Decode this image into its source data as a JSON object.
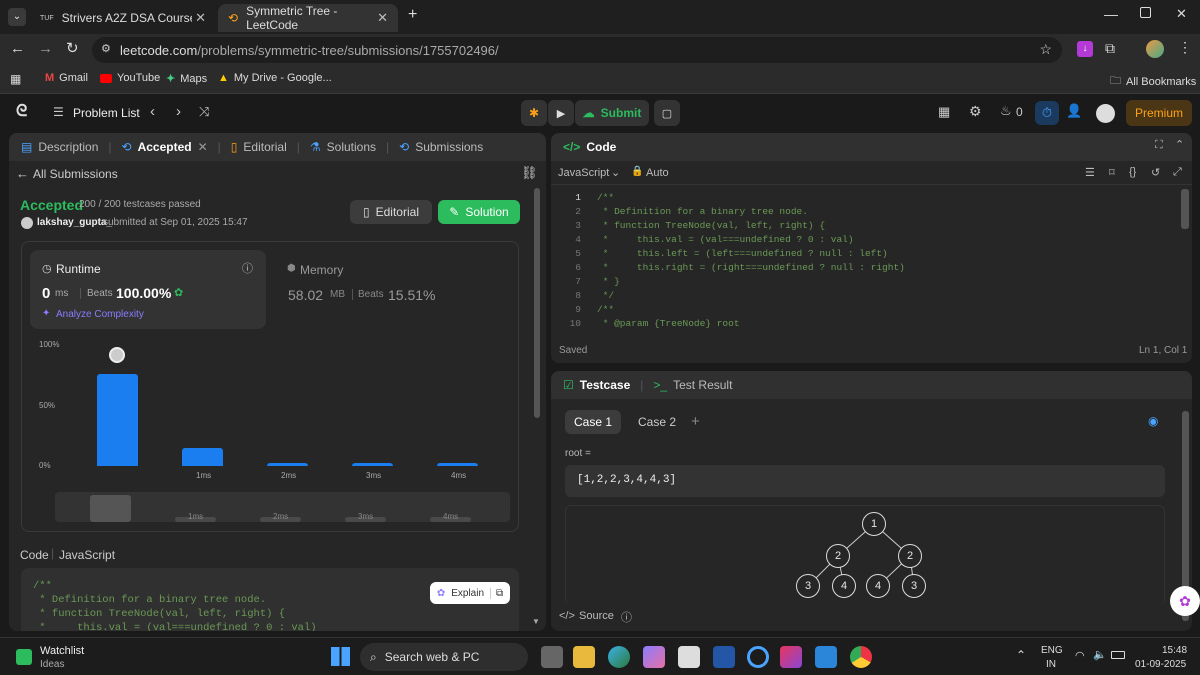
{
  "browser": {
    "tabs": [
      {
        "label": "Strivers A2Z DSA Course/Sheet",
        "favicon": "tuf"
      },
      {
        "label": "Symmetric Tree - LeetCode"
      }
    ],
    "url_host": "leetcode.com",
    "url_path": "/problems/symmetric-tree/submissions/1755702496/",
    "bookmarks": [
      "Gmail",
      "YouTube",
      "Maps",
      "My Drive - Google..."
    ],
    "all_bookmarks": "All Bookmarks"
  },
  "leetcode": {
    "problem_list": "Problem List",
    "submit": "Submit",
    "counter": "0",
    "premium": "Premium"
  },
  "left": {
    "tabs": [
      "Description",
      "Accepted",
      "Editorial",
      "Solutions",
      "Submissions"
    ],
    "back": "All Submissions",
    "status": "Accepted",
    "testcases": "200 / 200 testcases passed",
    "user": "lakshay_gupta_",
    "submitted": "submitted at Sep 01, 2025 15:47",
    "editorial_btn": "Editorial",
    "solution_btn": "Solution",
    "runtime_label": "Runtime",
    "runtime_value": "0",
    "runtime_unit": "ms",
    "beats_label": "Beats",
    "runtime_beats": "100.00%",
    "analyze": "Analyze Complexity",
    "memory_label": "Memory",
    "memory_value": "58.02",
    "memory_unit": "MB",
    "memory_beats": "15.51%",
    "code_label": "Code",
    "code_lang": "JavaScript",
    "explain": "Explain",
    "code_preview": [
      "/**",
      " * Definition for a binary tree node.",
      " * function TreeNode(val, left, right) {",
      " *     this.val = (val===undefined ? 0 : val)"
    ]
  },
  "chart_data": {
    "type": "bar",
    "categories": [
      "0ms",
      "1ms",
      "2ms",
      "3ms",
      "4ms"
    ],
    "x_tick_labels": [
      "",
      "1ms",
      "2ms",
      "3ms",
      "4ms"
    ],
    "values": [
      76,
      15,
      2.5,
      2.5,
      2.5
    ],
    "y_ticks": [
      "100%",
      "50%",
      "0%"
    ],
    "ylim": [
      0,
      100
    ],
    "highlight_category": "0ms",
    "bar_color": "#1a7ef0",
    "minimap_labels": [
      "1ms",
      "2ms",
      "3ms",
      "4ms"
    ]
  },
  "editor": {
    "title": "Code",
    "language": "JavaScript",
    "mode": "Auto",
    "lines": [
      "/**",
      " * Definition for a binary tree node.",
      " * function TreeNode(val, left, right) {",
      " *     this.val = (val===undefined ? 0 : val)",
      " *     this.left = (left===undefined ? null : left)",
      " *     this.right = (right===undefined ? null : right)",
      " * }",
      " */",
      "/**",
      " * @param {TreeNode} root"
    ],
    "line_numbers": [
      "1",
      "2",
      "3",
      "4",
      "5",
      "6",
      "7",
      "8",
      "9",
      "10"
    ],
    "saved": "Saved",
    "cursor": "Ln 1, Col 1"
  },
  "testcase": {
    "tab1": "Testcase",
    "tab2": "Test Result",
    "cases": [
      "Case 1",
      "Case 2"
    ],
    "input_label": "root =",
    "input_value": "[1,2,2,3,4,4,3]",
    "tree_nodes": [
      "1",
      "2",
      "2",
      "3",
      "4",
      "4",
      "3"
    ],
    "source": "Source"
  },
  "taskbar": {
    "watchlist": "Watchlist",
    "ideas": "Ideas",
    "search": "Search web & PC",
    "lang1": "ENG",
    "lang2": "IN",
    "time": "15:48",
    "date": "01-09-2025"
  },
  "colors": {
    "accepted": "#2cbb5d",
    "accent_blue": "#1a7ef0",
    "premium": "#ffa116"
  }
}
